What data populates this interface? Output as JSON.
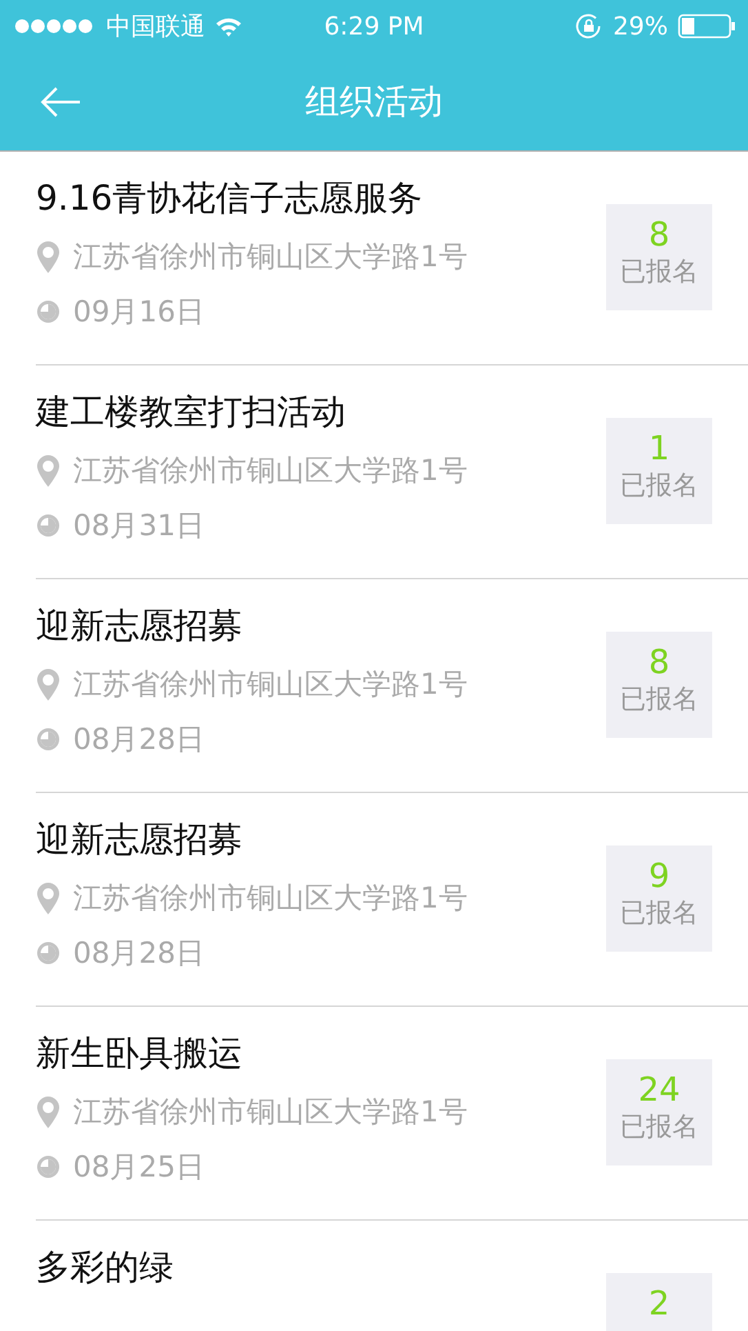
{
  "status_bar": {
    "carrier": "中国联通",
    "time": "6:29 PM",
    "battery": "29%"
  },
  "nav": {
    "title": "组织活动"
  },
  "activities": [
    {
      "title": "9.16青协花信子志愿服务",
      "address": "江苏省徐州市铜山区大学路1号",
      "date": "09月16日",
      "count": "8",
      "count_label": "已报名"
    },
    {
      "title": "建工楼教室打扫活动",
      "address": "江苏省徐州市铜山区大学路1号",
      "date": "08月31日",
      "count": "1",
      "count_label": "已报名"
    },
    {
      "title": "迎新志愿招募",
      "address": "江苏省徐州市铜山区大学路1号",
      "date": "08月28日",
      "count": "8",
      "count_label": "已报名"
    },
    {
      "title": "迎新志愿招募",
      "address": "江苏省徐州市铜山区大学路1号",
      "date": "08月28日",
      "count": "9",
      "count_label": "已报名"
    },
    {
      "title": "新生卧具搬运",
      "address": "江苏省徐州市铜山区大学路1号",
      "date": "08月25日",
      "count": "24",
      "count_label": "已报名"
    },
    {
      "title": "多彩的绿",
      "count": "2"
    }
  ]
}
